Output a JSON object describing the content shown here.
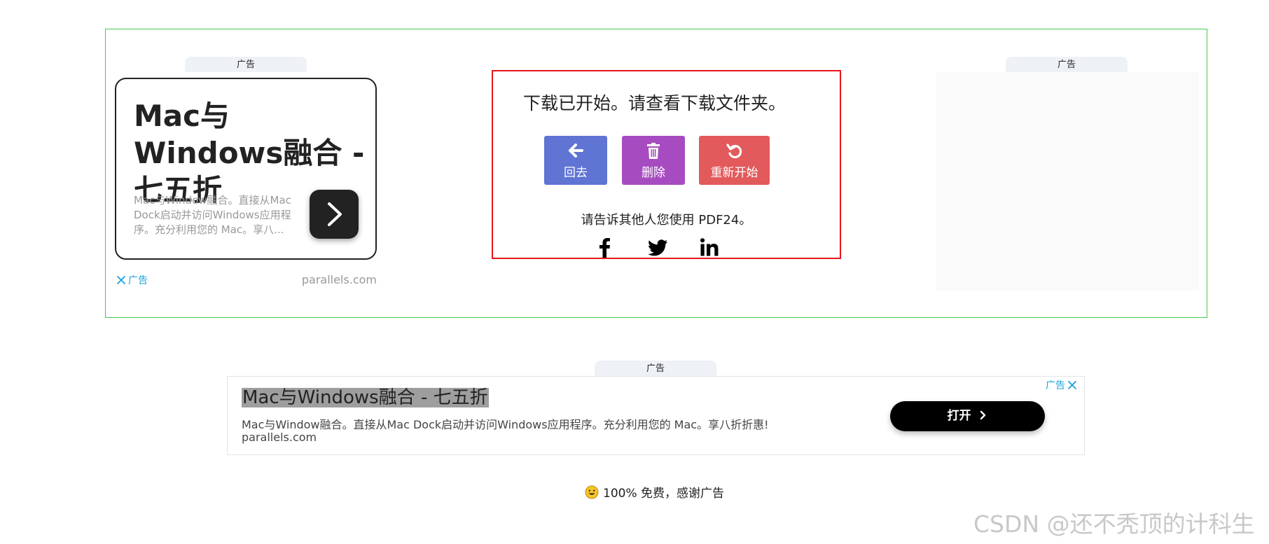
{
  "top_ad": {
    "left_tab": "广告",
    "right_tab": "广告",
    "left_card": {
      "headline": "Mac与Windows融合 - 七五折",
      "description": "Mac与Window融合。直接从Mac Dock启动并访问Windows应用程序。充分利用您的 Mac。享八...",
      "ad_label": "广告",
      "domain": "parallels.com"
    }
  },
  "status": {
    "message": "下载已开始。请查看下载文件夹。",
    "buttons": {
      "back": "回去",
      "delete": "删除",
      "restart": "重新开始"
    },
    "share_text": "请告诉其他人您使用 PDF24。"
  },
  "banner_ad": {
    "tab": "广告",
    "title": "Mac与Windows融合 - 七五折",
    "description": "Mac与Window融合。直接从Mac Dock启动并访问Windows应用程序。充分利用您的 Mac。享八折折惠!",
    "domain": "parallels.com",
    "ad_label": "广告",
    "open_label": "打开"
  },
  "footer": {
    "note": "100% 免费，感谢广告"
  },
  "watermark": "CSDN @还不秃顶的计科生",
  "colors": {
    "frame_green": "#4cc94c",
    "box_red": "#e8141c",
    "btn_back": "#5f74d3",
    "btn_delete": "#a64cc0",
    "btn_restart": "#e25a5c",
    "ad_blue": "#1aa2dc"
  },
  "icons": {
    "back": "arrow-left-icon",
    "delete": "trash-icon",
    "restart": "rotate-left-icon",
    "facebook": "facebook-icon",
    "twitter": "twitter-icon",
    "linkedin": "linkedin-icon",
    "close": "close-icon",
    "chevron": "chevron-right-icon",
    "smile": "smile-emoji-icon"
  }
}
